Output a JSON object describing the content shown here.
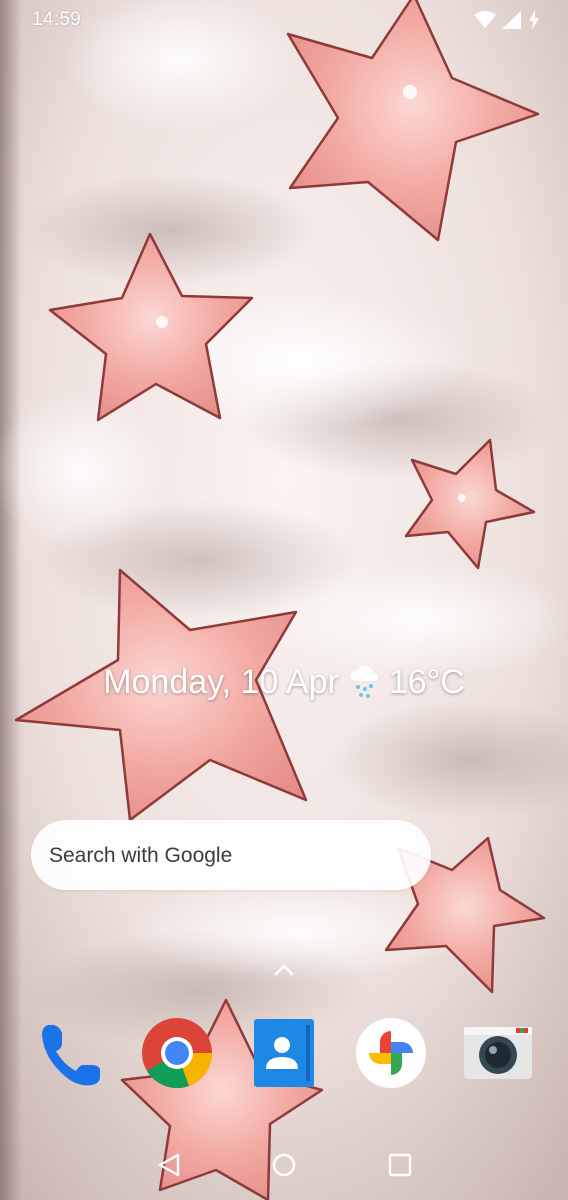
{
  "status_bar": {
    "time": "14:59",
    "icons": [
      "wifi-icon",
      "cell-signal-icon",
      "battery-charging-icon"
    ]
  },
  "date_widget": {
    "date": "Monday, 10 Apr",
    "weather_icon": "rain-cloud-icon",
    "temperature": "16°C"
  },
  "search": {
    "placeholder": "Search with Google"
  },
  "app_drawer_hint": "chevron-up-icon",
  "dock": {
    "apps": [
      "phone-icon",
      "chrome-icon",
      "contacts-icon",
      "photos-icon",
      "camera-icon"
    ]
  },
  "nav_bar": {
    "buttons": [
      "back-icon",
      "home-icon",
      "recents-icon"
    ]
  },
  "colors": {
    "wallpaper_base": "#f1e6e3",
    "star_fill": "#f2aaa6",
    "star_outline": "#8e3a3a",
    "search_bg": "#ffffff",
    "phone_blue": "#1a73e8"
  }
}
